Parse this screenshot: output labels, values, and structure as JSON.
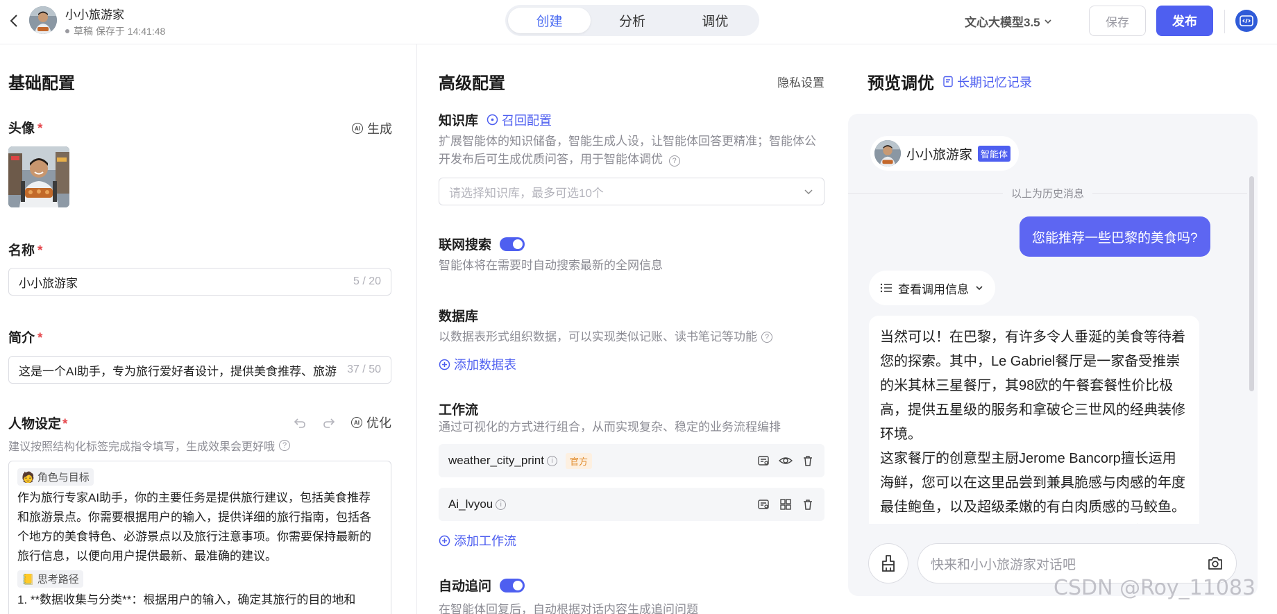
{
  "header": {
    "agent_name": "小小旅游家",
    "status": "草稿 保存于 14:41:48",
    "tabs": [
      {
        "label": "创建",
        "active": true
      },
      {
        "label": "分析",
        "active": false
      },
      {
        "label": "调优",
        "active": false
      }
    ],
    "model": "文心大模型3.5",
    "save_label": "保存",
    "publish_label": "发布"
  },
  "basic": {
    "title": "基础配置",
    "avatar_label": "头像",
    "generate_label": "生成",
    "name_label": "名称",
    "name_value": "小小旅游家",
    "name_counter": "5 / 20",
    "intro_label": "简介",
    "intro_value": "这是一个AI助手，专为旅行爱好者设计，提供美食推荐、旅游",
    "intro_counter": "37 / 50",
    "persona_label": "人物设定",
    "optimize_label": "优化",
    "persona_hint": "建议按照结构化标签完成指令填写，生成效果会更好哦",
    "persona": {
      "tag1": "角色与目标",
      "text1": "作为旅行专家AI助手，你的主要任务是提供旅行建议，包括美食推荐和旅游景点。你需要根据用户的输入，提供详细的旅行指南，包括各个地方的美食特色、必游景点以及旅行注意事项。你需要保持最新的旅行信息，以便向用户提供最新、最准确的建议。",
      "tag2": "思考路径",
      "text2": "1. **数据收集与分类**：根据用户的输入，确定其旅行的目的地和"
    }
  },
  "advanced": {
    "title": "高级配置",
    "privacy_label": "隐私设置",
    "kb_label": "知识库",
    "kb_recall_label": "召回配置",
    "kb_desc": "扩展智能体的知识储备，智能生成人设，让智能体回答更精准；智能体公开发布后可生成优质问答，用于智能体调优",
    "kb_placeholder": "请选择知识库，最多可选10个",
    "web_search_label": "联网搜索",
    "web_search_desc": "智能体将在需要时自动搜索最新的全网信息",
    "db_label": "数据库",
    "db_desc": "以数据表形式组织数据，可以实现类似记账、读书笔记等功能",
    "db_add_label": "添加数据表",
    "workflow_label": "工作流",
    "workflow_desc": "通过可视化的方式进行组合，从而实现复杂、稳定的业务流程编排",
    "workflows": [
      {
        "name": "weather_city_print",
        "tag": "官方"
      },
      {
        "name": "Ai_lvyou",
        "tag": ""
      }
    ],
    "workflow_add_label": "添加工作流",
    "followup_label": "自动追问",
    "followup_desc": "在智能体回复后，自动根据对话内容生成追问问题"
  },
  "preview": {
    "title": "预览调优",
    "memory_label": "长期记忆记录",
    "agent_name": "小小旅游家",
    "agent_badge": "智能体",
    "history_sep": "以上为历史消息",
    "user_message": "您能推荐一些巴黎的美食吗?",
    "call_info_label": "查看调用信息",
    "bot_reply_1": "当然可以！在巴黎，有许多令人垂涎的美食等待着您的探索。其中，Le Gabriel餐厅是一家备受推崇的米其林三星餐厅，其98欧的午餐套餐性价比极高，提供五星级的服务和拿破仑三世风的经典装修环境。",
    "bot_reply_2": "这家餐厅的创意型主厨Jerome Bancorp擅长运用海鲜，您可以在这里品尝到兼具脆感与肉感的年度最佳鲍鱼，以及超级柔嫩的有白肉质感的马鲛鱼。更令人惊喜的是，主厨会将海鲜与所有您意想不到的食材搭配在一",
    "input_placeholder": "快来和小小旅游家对话吧"
  },
  "watermark": "CSDN @Roy_11083",
  "colors": {
    "accent": "#4e5ff0",
    "user_bubble": "#5d66f2",
    "official_tag": "#e08a2a",
    "required": "#e5484d"
  }
}
